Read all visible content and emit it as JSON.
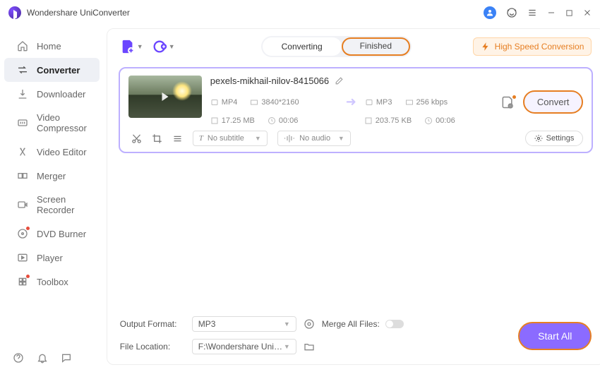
{
  "app": {
    "title": "Wondershare UniConverter"
  },
  "window_controls": {
    "user_badge": "👤"
  },
  "sidebar": {
    "items": [
      {
        "label": "Home"
      },
      {
        "label": "Converter"
      },
      {
        "label": "Downloader"
      },
      {
        "label": "Video Compressor"
      },
      {
        "label": "Video Editor"
      },
      {
        "label": "Merger"
      },
      {
        "label": "Screen Recorder"
      },
      {
        "label": "DVD Burner"
      },
      {
        "label": "Player"
      },
      {
        "label": "Toolbox"
      }
    ]
  },
  "tabs": {
    "converting": "Converting",
    "finished": "Finished"
  },
  "high_speed_label": "High Speed Conversion",
  "item": {
    "filename": "pexels-mikhail-nilov-8415066",
    "src": {
      "format": "MP4",
      "resolution": "3840*2160",
      "size": "17.25 MB",
      "duration": "00:06"
    },
    "dst": {
      "format": "MP3",
      "bitrate": "256 kbps",
      "size": "203.75 KB",
      "duration": "00:06"
    },
    "subtitle_label": "No subtitle",
    "audio_label": "No audio",
    "settings_label": "Settings",
    "convert_label": "Convert"
  },
  "footer": {
    "output_format_label": "Output Format:",
    "output_format_value": "MP3",
    "file_location_label": "File Location:",
    "file_location_value": "F:\\Wondershare UniConverter",
    "merge_label": "Merge All Files:",
    "start_all_label": "Start All"
  }
}
